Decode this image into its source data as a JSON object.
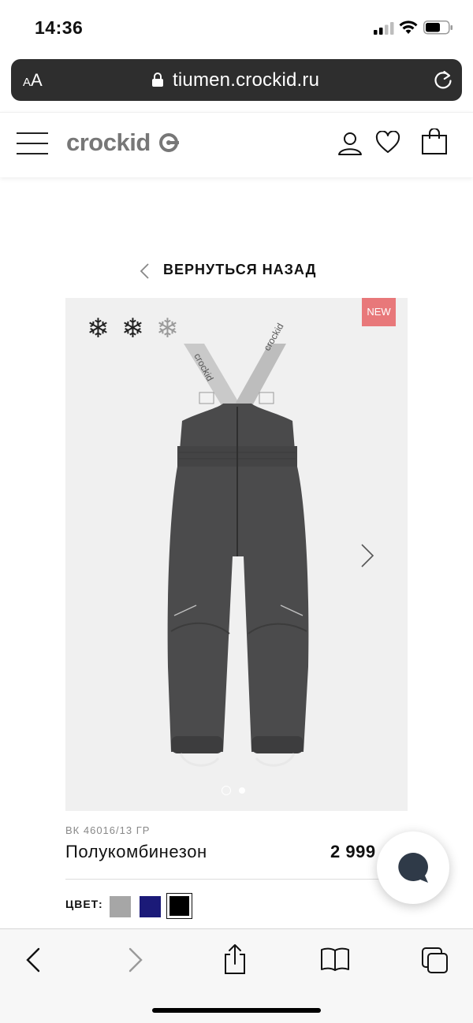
{
  "status_bar": {
    "time": "14:36"
  },
  "browser": {
    "text_size_label_small": "A",
    "text_size_label_large": "A",
    "url": "tiumen.crockid.ru"
  },
  "site": {
    "logo": "crockid"
  },
  "back": {
    "label": "ВЕРНУТЬСЯ НАЗАД"
  },
  "product": {
    "badge": "NEW",
    "sku": "ВК 46016/13 ГР",
    "name": "Полукомбинезон",
    "price": "2 999",
    "warmth_level": 2,
    "warmth_max": 3,
    "color_label": "ЦВЕТ:",
    "colors": [
      {
        "name": "grey",
        "hex": "#a6a6a6",
        "selected": false
      },
      {
        "name": "navy",
        "hex": "#1b1a78",
        "selected": false
      },
      {
        "name": "black",
        "hex": "#000000",
        "selected": true
      }
    ],
    "gallery": {
      "current": 1,
      "total": 2
    },
    "strap_text": "crockid"
  },
  "colors": {
    "badge_bg": "#e8787a",
    "accent_dark": "#111111",
    "image_bg": "#f0f0f0"
  }
}
